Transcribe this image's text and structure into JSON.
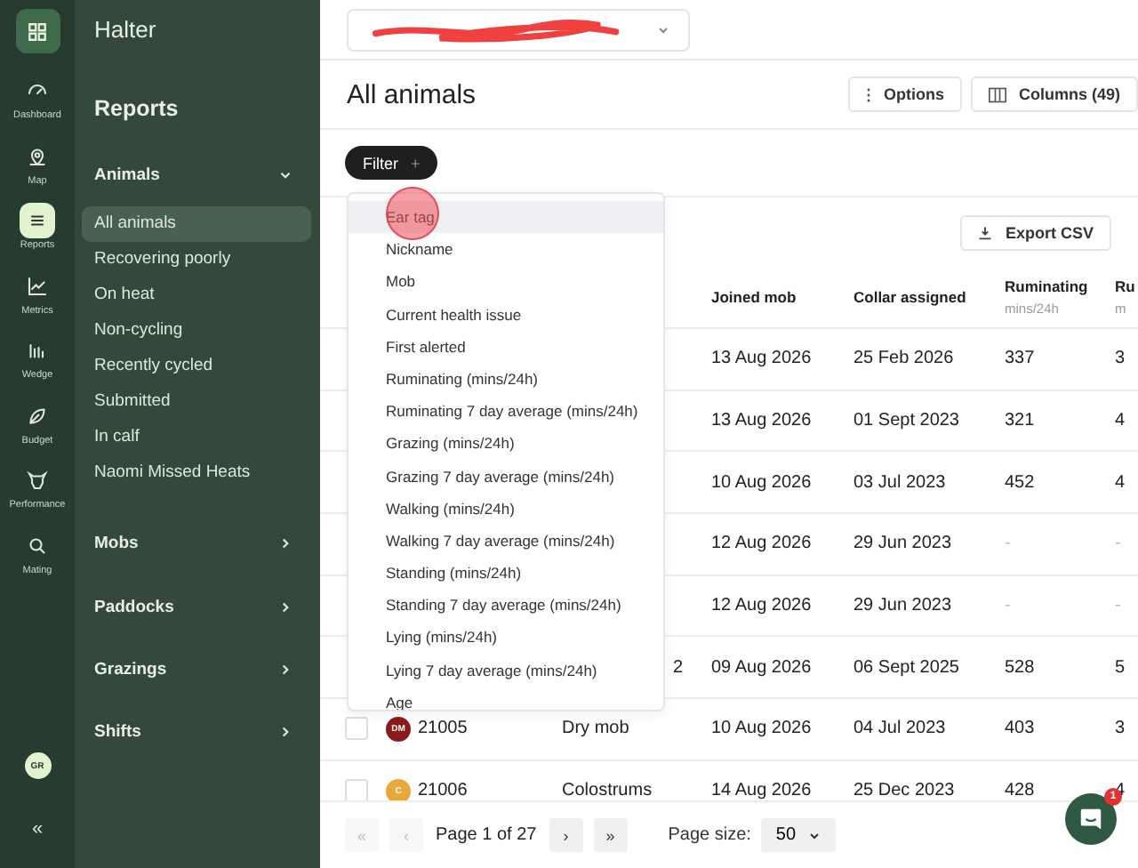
{
  "rail": {
    "items": [
      {
        "label": "Dashboard",
        "selected": false
      },
      {
        "label": "Map",
        "selected": false
      },
      {
        "label": "Reports",
        "selected": true
      },
      {
        "label": "Metrics",
        "selected": false
      },
      {
        "label": "Wedge",
        "selected": false
      },
      {
        "label": "Budget",
        "selected": false
      },
      {
        "label": "Performance",
        "selected": false
      },
      {
        "label": "Mating",
        "selected": false
      }
    ],
    "avatar": "GR",
    "collapse": "«"
  },
  "sidebar": {
    "brand": "Halter",
    "title": "Reports",
    "sections": [
      {
        "label": "Animals",
        "expanded": true,
        "items": [
          {
            "label": "All animals",
            "selected": true
          },
          {
            "label": "Recovering poorly",
            "selected": false
          },
          {
            "label": "On heat",
            "selected": false
          },
          {
            "label": "Non-cycling",
            "selected": false
          },
          {
            "label": "Recently cycled",
            "selected": false
          },
          {
            "label": "Submitted",
            "selected": false
          },
          {
            "label": "In calf",
            "selected": false
          },
          {
            "label": "Naomi Missed Heats",
            "selected": false
          }
        ]
      },
      {
        "label": "Mobs",
        "expanded": false
      },
      {
        "label": "Paddocks",
        "expanded": false
      },
      {
        "label": "Grazings",
        "expanded": false
      },
      {
        "label": "Shifts",
        "expanded": false
      }
    ]
  },
  "page": {
    "title": "All animals",
    "options": "Options",
    "columns": "Columns (49)",
    "filter": "Filter",
    "filter_icon": "+",
    "export": "Export CSV"
  },
  "table": {
    "columns": [
      {
        "label": "Joined mob"
      },
      {
        "label": "Collar assigned"
      },
      {
        "label": "Ruminating",
        "sub": "mins/24h"
      },
      {
        "label": "Ru",
        "sub": "m"
      }
    ],
    "rows": [
      {
        "covered": true,
        "joined": "13 Aug 2026",
        "collar": "25 Feb 2026",
        "rum": "337",
        "col_4": "3"
      },
      {
        "covered": true,
        "joined": "13 Aug 2026",
        "collar": "01 Sept 2023",
        "rum": "321",
        "col_4": "4"
      },
      {
        "covered": true,
        "joined": "10 Aug 2026",
        "collar": "03 Jul 2023",
        "rum": "452",
        "col_4": "4"
      },
      {
        "covered": true,
        "joined": "12 Aug 2026",
        "collar": "29 Jun 2023",
        "rum": "-",
        "col_4": "-"
      },
      {
        "covered": true,
        "joined": "12 Aug 2026",
        "collar": "29 Jun 2023",
        "rum": "-",
        "col_4": "-"
      },
      {
        "covered": true,
        "mob": "2",
        "joined": "09 Aug 2026",
        "collar": "06 Sept 2025",
        "rum": "528",
        "col_4": "5"
      },
      {
        "covered": false,
        "checked": false,
        "badge": "DM",
        "color": "#8b1a1a",
        "tag": "21005",
        "mob": "Dry mob",
        "joined": "10 Aug 2026",
        "collar": "04 Jul 2023",
        "rum": "403",
        "col_4": "3"
      },
      {
        "covered": false,
        "checked": false,
        "badge": "C",
        "color": "#e8a93a",
        "tag": "21006",
        "mob": "Colostrums",
        "joined": "14 Aug 2026",
        "collar": "25 Dec 2023",
        "rum": "428",
        "col_4": "4"
      }
    ]
  },
  "filter_menu": {
    "items": [
      {
        "label": "Ear tag",
        "selected": true
      },
      {
        "label": "Nickname",
        "selected": false
      },
      {
        "label": "Mob",
        "selected": false
      },
      {
        "label": "Current health issue",
        "selected": false
      },
      {
        "label": "First alerted",
        "selected": false
      },
      {
        "label": "Ruminating (mins/24h)",
        "selected": false
      },
      {
        "label": "Ruminating 7 day average (mins/24h)",
        "selected": false
      },
      {
        "label": "Grazing (mins/24h)",
        "selected": false
      },
      {
        "label": "Grazing 7 day average (mins/24h)",
        "selected": false
      },
      {
        "label": "Walking (mins/24h)",
        "selected": false
      },
      {
        "label": "Walking 7 day average (mins/24h)",
        "selected": false
      },
      {
        "label": "Standing (mins/24h)",
        "selected": false
      },
      {
        "label": "Standing 7 day average (mins/24h)",
        "selected": false
      },
      {
        "label": "Lying (mins/24h)",
        "selected": false
      },
      {
        "label": "Lying 7 day average (mins/24h)",
        "selected": false
      },
      {
        "label": "Age",
        "selected": false
      }
    ]
  },
  "pager": {
    "first": {
      "label": "«",
      "disabled": true
    },
    "prev": {
      "label": "‹",
      "disabled": true
    },
    "status": "Page 1 of 27",
    "next": {
      "label": "›",
      "disabled": false
    },
    "last": {
      "label": "»",
      "disabled": false
    },
    "size_label": "Page size:",
    "size": "50"
  },
  "chat": {
    "badge": "1"
  }
}
